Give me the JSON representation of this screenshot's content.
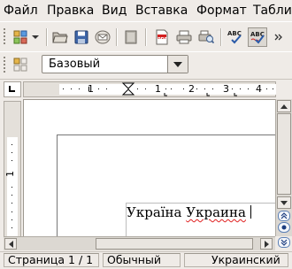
{
  "menubar": {
    "items": [
      "Файл",
      "Правка",
      "Вид",
      "Вставка",
      "Формат",
      "Табли"
    ]
  },
  "toolbar_standard": {
    "buttons": [
      "toolbar-options-icon",
      "new-document-icon",
      "open-folder-icon",
      "save-disk-icon",
      "email-envelope-icon",
      "edit-mode-icon",
      "export-pdf-icon",
      "print-icon",
      "print-preview-icon",
      "spellcheck-icon",
      "autospellcheck-icon"
    ],
    "pdf_label": "PDF",
    "spell_label": "ABC"
  },
  "formatting": {
    "style_value": "Базовый"
  },
  "ruler": {
    "h_numbers": [
      "1",
      "1",
      "2",
      "3",
      "4"
    ],
    "v_numbers": [
      "1"
    ]
  },
  "document": {
    "word1": "Україна",
    "word2": "Украина"
  },
  "statusbar": {
    "page": "Страница  1 / 1",
    "style": "Обычный",
    "language": "Украинский"
  }
}
